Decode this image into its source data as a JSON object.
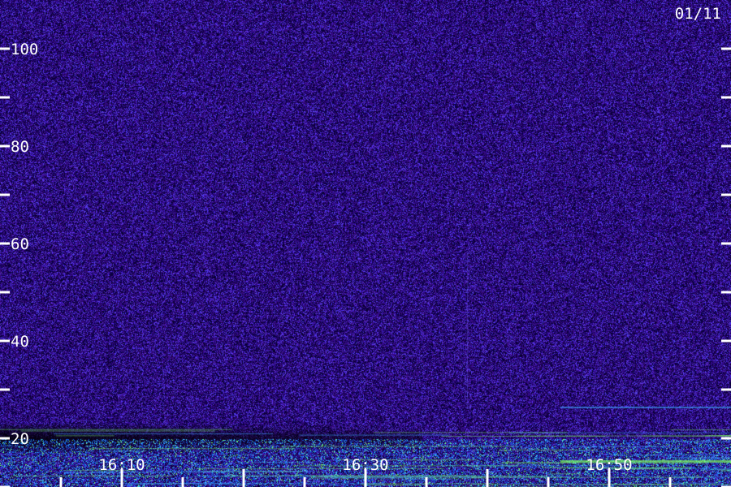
{
  "chart_data": {
    "type": "heatmap",
    "date_label": "01/11",
    "y_axis": {
      "range": [
        10,
        110
      ],
      "major_ticks": [
        20,
        40,
        60,
        80,
        100
      ],
      "minor_ticks": [
        10,
        30,
        50,
        70,
        90
      ],
      "tick_labels": [
        "20",
        "40",
        "60",
        "80",
        "100"
      ]
    },
    "x_axis": {
      "range": [
        "16:00",
        "17:00"
      ],
      "labeled_ticks": [
        "16:10",
        "16:30",
        "16:50"
      ],
      "tick_minutes": [
        5,
        10,
        15,
        20,
        25,
        30,
        35,
        40,
        45,
        50,
        55
      ]
    },
    "colors": {
      "background": "#2a1070",
      "noise_high": "#5a3ce0",
      "band_cyan": "#3fa8ff",
      "band_green": "#7dff60",
      "quiet_zone": "#050018"
    }
  }
}
